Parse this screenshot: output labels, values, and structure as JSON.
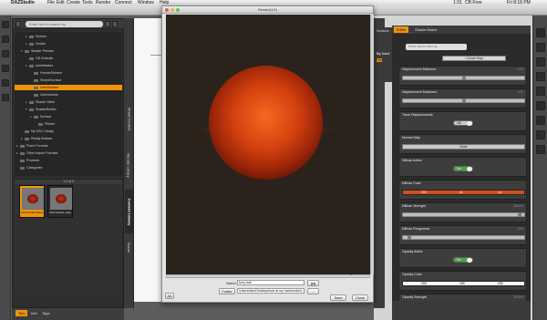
{
  "menubar": {
    "apple": "",
    "app": "DAZStudio",
    "items": [
      "File",
      "Edit",
      "Create",
      "Tools",
      "Render",
      "Connect",
      "Window",
      "Help"
    ],
    "status_battery": "1:31",
    "status_cb": "CB Free",
    "status_time": "Fri 8:18 PM"
  },
  "content_library": {
    "search_placeholder": "Enter text to search by",
    "tree": [
      {
        "label": "Scenes",
        "level": 2,
        "twisty": "▸"
      },
      {
        "label": "Scripts",
        "level": 2,
        "twisty": "▸"
      },
      {
        "label": "Shader Presets",
        "level": 1,
        "twisty": "▾"
      },
      {
        "label": "CB Defaults",
        "level": 2,
        "twisty": ""
      },
      {
        "label": "omnifreaker",
        "level": 2,
        "twisty": "▾"
      },
      {
        "label": "HumanSurface",
        "level": 3,
        "twisty": ""
      },
      {
        "label": "SimpleSurface",
        "level": 3,
        "twisty": ""
      },
      {
        "label": "UberSurface",
        "level": 3,
        "twisty": "",
        "selected": true
      },
      {
        "label": "UberVolume",
        "level": 3,
        "twisty": ""
      },
      {
        "label": "Shader Mixer",
        "level": 2,
        "twisty": "▸"
      },
      {
        "label": "ShaderBuilder",
        "level": 2,
        "twisty": "▾"
      },
      {
        "label": "Surface",
        "level": 3,
        "twisty": "▸"
      },
      {
        "label": "Pitheer",
        "level": 4,
        "twisty": ""
      },
      {
        "label": "My DAZ Library",
        "level": 1,
        "twisty": ""
      },
      {
        "label": "Ready Avatars",
        "level": 1,
        "twisty": "▸"
      },
      {
        "label": "Poser Formats",
        "level": 0,
        "twisty": "▸"
      },
      {
        "label": "Other Import Formats",
        "level": 0,
        "twisty": "▸"
      },
      {
        "label": "Products",
        "level": 0,
        "twisty": ""
      },
      {
        "label": "Categories",
        "level": 0,
        "twisty": ""
      }
    ],
    "pager": "1-2 of 2",
    "thumbs": [
      {
        "caption": "UberSurface Base",
        "selected": true
      },
      {
        "caption": "UberSurface Help",
        "selected": false
      }
    ],
    "bottom_tabs": [
      "Tips",
      "Info",
      "Tags"
    ]
  },
  "vertical_tabs": [
    "Smart Content",
    "Render Library",
    "Content Library",
    "Scene"
  ],
  "render_window": {
    "title": "Render(1/1)",
    "name_label": "Name:",
    "name_value": "furry ball",
    "format": "jpg",
    "folder_label": "Folder",
    "folder_path": "/Users/dan/Desktop/look at my hair/renders",
    "folder_button": "...",
    "save_button": "Save",
    "close_button": "Close",
    "bottom_left_button": "AA"
  },
  "surfaces_tab_strip": {
    "label_top": "Surfaces",
    "label_used": "My Used",
    "label_file": "File"
  },
  "shader_baker": {
    "tabs": [
      "Editor",
      "Shader Baker"
    ],
    "search_placeholder": "Enter text to filter by",
    "choose_map": "Choose Map",
    "properties": [
      {
        "name": "Displacement Minimum",
        "value": "-0.10",
        "type": "slider",
        "knob": 0.5
      },
      {
        "name": "Displacement Maximum",
        "value": "0.10",
        "type": "slider",
        "knob": 0.5
      },
      {
        "name": "Trace Displacements",
        "value": "",
        "type": "toggle",
        "toggle": "Off"
      },
      {
        "name": "Normal Map",
        "value": "",
        "type": "box",
        "box": "None"
      },
      {
        "name": "Diffuse Active",
        "value": "",
        "type": "toggle",
        "toggle": "On",
        "on": true
      },
      {
        "name": "Diffuse Color",
        "value": "",
        "type": "color",
        "rgb": [
          "203",
          "41",
          "14"
        ]
      },
      {
        "name": "Diffuse Strength",
        "value": "100.0%",
        "type": "slider",
        "knob": 0.98
      },
      {
        "name": "Diffuse Roughness",
        "value": "0.00",
        "type": "slider",
        "knob": 0.04
      },
      {
        "name": "Opacity Active",
        "value": "",
        "type": "toggle",
        "toggle": "On",
        "on": true
      },
      {
        "name": "Opacity Color",
        "value": "",
        "type": "color",
        "white": true,
        "rgb": [
          "255",
          "255",
          "255"
        ]
      },
      {
        "name": "Opacity Strength",
        "value": "100.0%",
        "type": "slider",
        "knob": 0.98
      }
    ]
  }
}
